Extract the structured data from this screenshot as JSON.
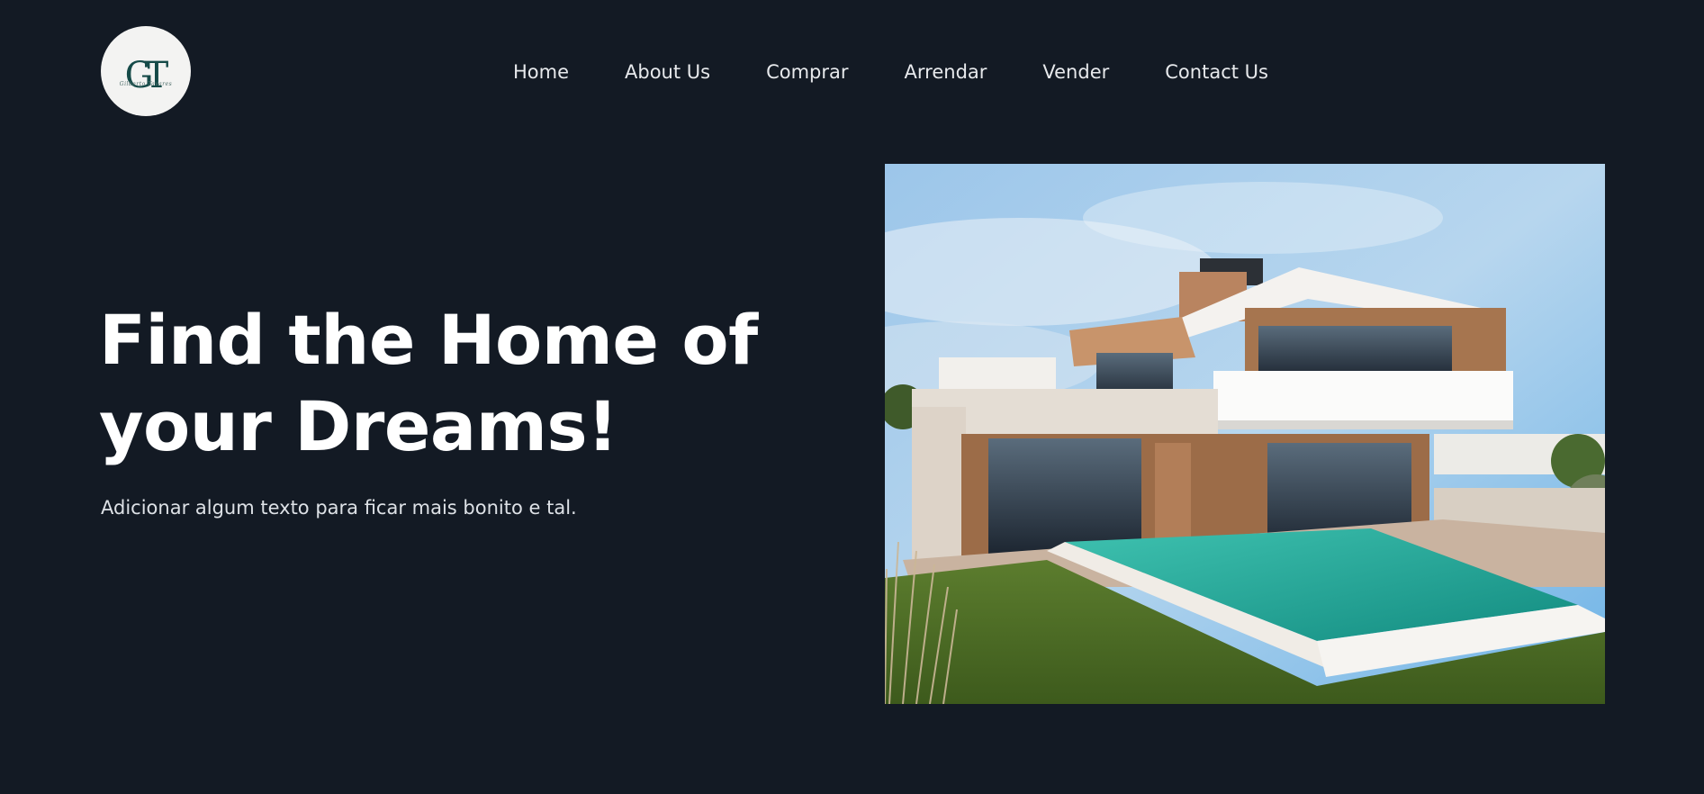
{
  "brand": {
    "logo_text": "GT",
    "logo_subtext": "Gilberto Tavares"
  },
  "nav": {
    "items": [
      {
        "label": "Home"
      },
      {
        "label": "About Us"
      },
      {
        "label": "Comprar"
      },
      {
        "label": "Arrendar"
      },
      {
        "label": "Vender"
      },
      {
        "label": "Contact Us"
      }
    ]
  },
  "hero": {
    "title_line1": "Find the Home of",
    "title_line2": "your Dreams!",
    "subtitle": "Adicionar algum texto para ficar mais bonito e tal.",
    "image_subject": "modern-villa-with-pool"
  },
  "colors": {
    "background": "#131a24",
    "text": "#ffffff",
    "nav_text": "#e7e9ec",
    "logo_bg": "#f3f3f2",
    "logo_mark": "#154a48"
  }
}
